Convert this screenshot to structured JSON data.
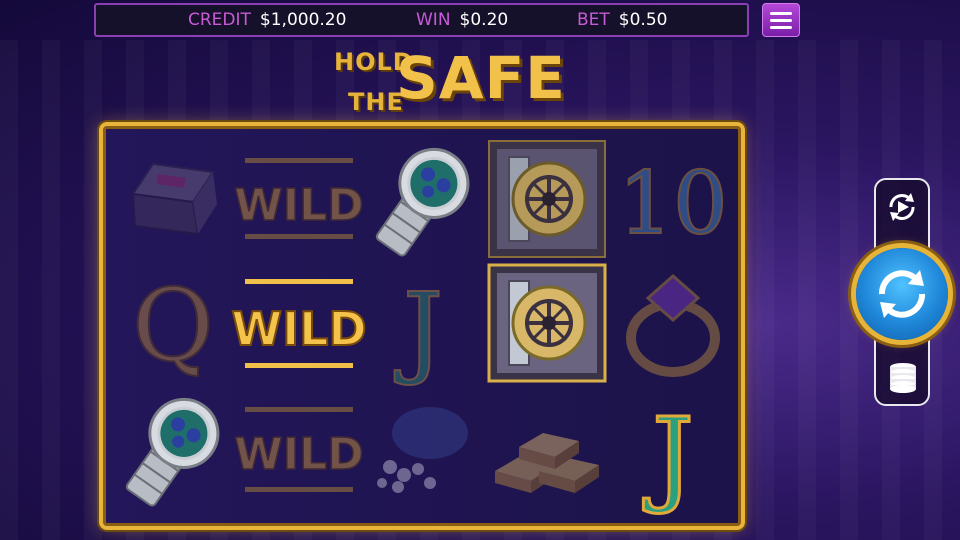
{
  "status_bar": {
    "credit_label": "CREDIT",
    "credit_value": "$1,000.20",
    "win_label": "WIN",
    "win_value": "$0.20",
    "bet_label": "BET",
    "bet_value": "$0.50"
  },
  "logo": {
    "line1": "HOLD",
    "line2": "THE",
    "line3": "SAFE"
  },
  "colors": {
    "accent_purple": "#c85ad6",
    "gold": "#e8b53a",
    "spin_blue": "#1f86d8"
  },
  "reels": {
    "rows": [
      [
        "briefcase",
        "wild",
        "watch",
        "safe",
        "ten"
      ],
      [
        "queen",
        "wild",
        "jack",
        "safe",
        "ring"
      ],
      [
        "watch",
        "wild",
        "diamonds",
        "gold-bars",
        "jack"
      ]
    ],
    "highlighted": [
      [
        false,
        false,
        true,
        false,
        false
      ],
      [
        false,
        true,
        false,
        true,
        false
      ],
      [
        true,
        false,
        false,
        false,
        true
      ]
    ],
    "wild_text": "WILD",
    "ten_text": "10",
    "queen_text": "Q",
    "jack_text": "J"
  },
  "controls": {
    "menu_icon": "hamburger-menu-icon",
    "autoplay_icon": "autoplay-icon",
    "spin_icon": "spin-arrows-icon",
    "bet_icon": "coin-stack-icon"
  }
}
